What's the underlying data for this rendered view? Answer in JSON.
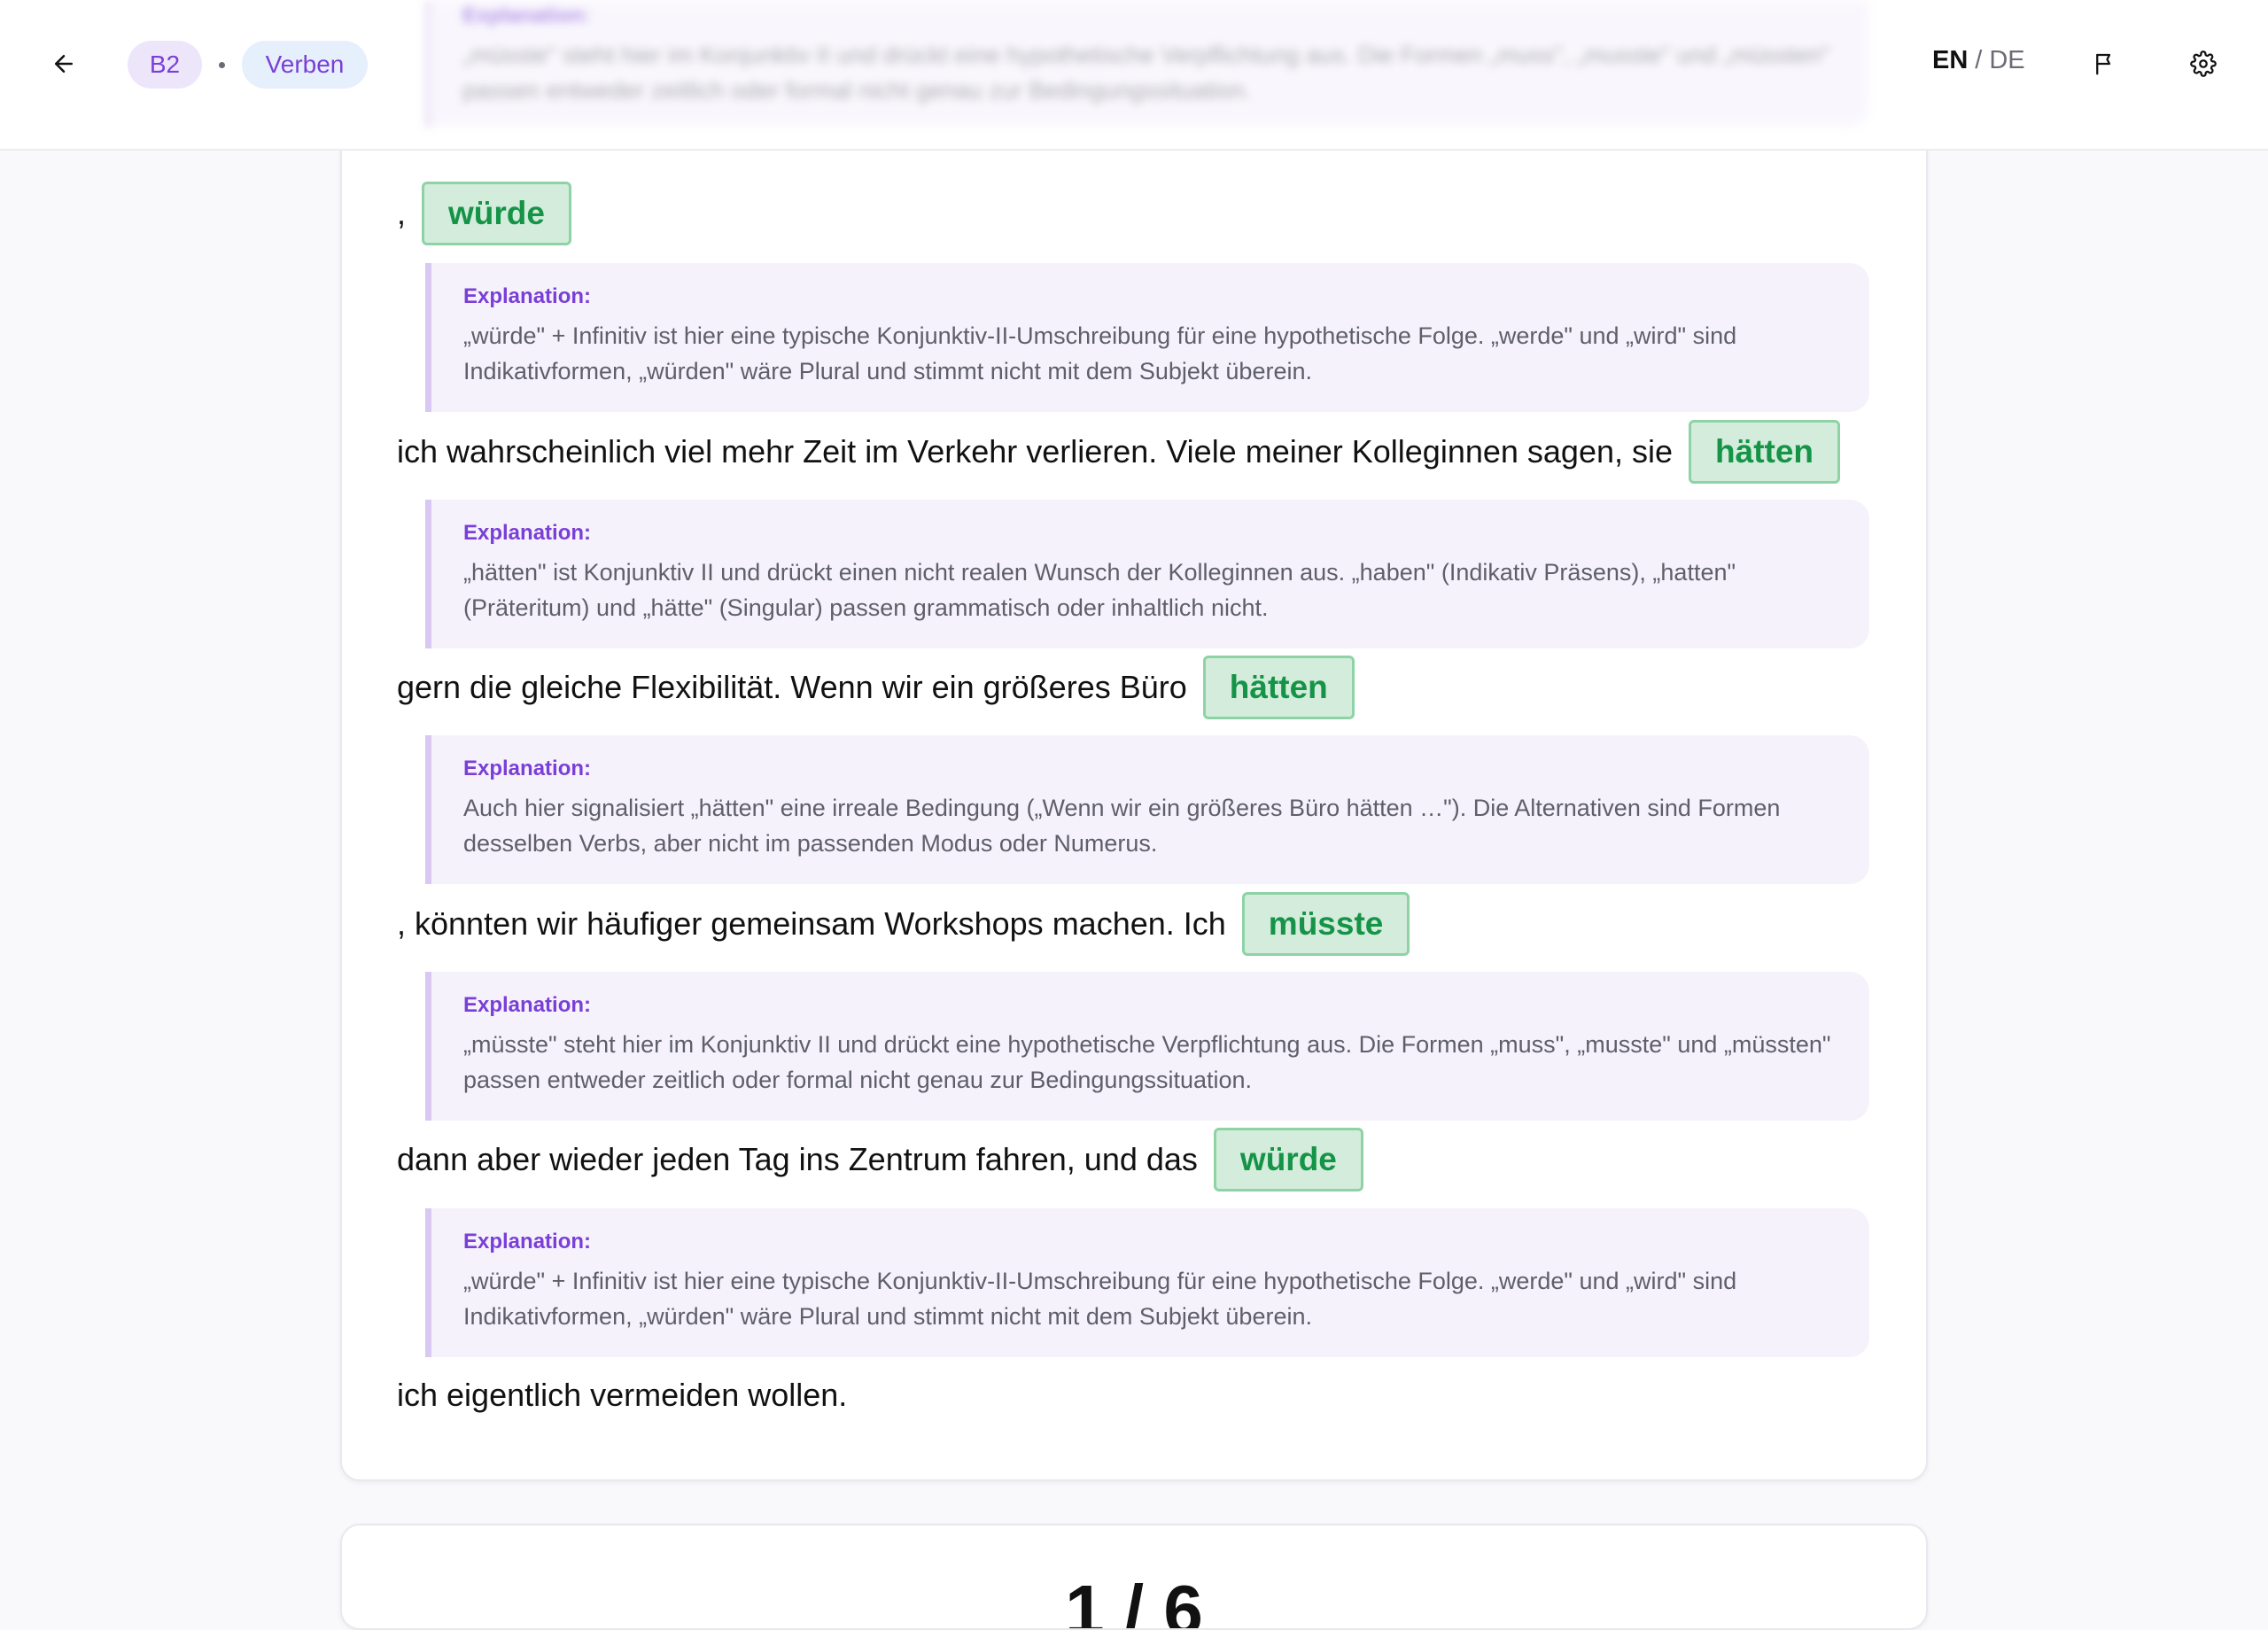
{
  "header": {
    "level": "B2",
    "topic": "Verben",
    "lang_en": "EN",
    "lang_sep": "/",
    "lang_de": "DE",
    "ghost_label": "Explanation:",
    "ghost_text": "„müsste\" steht hier im Konjunktiv II und drückt eine hypothetische Verpflichtung aus. Die Formen „muss\", „musste\" und „müssten\" passen entweder zeitlich oder formal nicht genau zur Bedingungssituation."
  },
  "exercise": {
    "explanation_label": "Explanation:",
    "segments": [
      {
        "text": ",",
        "answer": "würde",
        "explanation": "„würde\" + Infinitiv ist hier eine typische Konjunktiv-II-Umschreibung für eine hypothetische Folge. „werde\" und „wird\" sind Indikativformen, „würden\" wäre Plural und stimmt nicht mit dem Subjekt überein."
      },
      {
        "text": "ich wahrscheinlich viel mehr Zeit im Verkehr verlieren. Viele meiner Kolleginnen sagen, sie",
        "answer": "hätten",
        "explanation": "„hätten\" ist Konjunktiv II und drückt einen nicht realen Wunsch der Kolleginnen aus. „haben\" (Indikativ Präsens), „hatten\" (Präteritum) und „hätte\" (Singular) passen grammatisch oder inhaltlich nicht."
      },
      {
        "text": "gern die gleiche Flexibilität. Wenn wir ein größeres Büro",
        "answer": "hätten",
        "explanation": "Auch hier signalisiert „hätten\" eine irreale Bedingung („Wenn wir ein größeres Büro hätten …\"). Die Alternativen sind Formen desselben Verbs, aber nicht im passenden Modus oder Numerus."
      },
      {
        "text": ", könnten wir häufiger gemeinsam Workshops machen. Ich",
        "answer": "müsste",
        "explanation": "„müsste\" steht hier im Konjunktiv II und drückt eine hypothetische Verpflichtung aus. Die Formen „muss\", „musste\" und „müssten\" passen entweder zeitlich oder formal nicht genau zur Bedingungssituation."
      },
      {
        "text": "dann aber wieder jeden Tag ins Zentrum fahren, und das",
        "answer": "würde",
        "explanation": "„würde\" + Infinitiv ist hier eine typische Konjunktiv-II-Umschreibung für eine hypothetische Folge. „werde\" und „wird\" sind Indikativformen, „würden\" wäre Plural und stimmt nicht mit dem Subjekt überein."
      }
    ],
    "final_text": "ich eigentlich vermeiden wollen."
  },
  "pager": {
    "counter": "1 / 6"
  },
  "icons": {
    "back": "arrow-left-icon",
    "flag": "flag-icon",
    "settings": "gear-icon"
  },
  "colors": {
    "accent_purple": "#7a3fd6",
    "answer_green": "#159447",
    "answer_bg": "#d4ecdc",
    "explanation_bg": "#f5f2fc"
  }
}
